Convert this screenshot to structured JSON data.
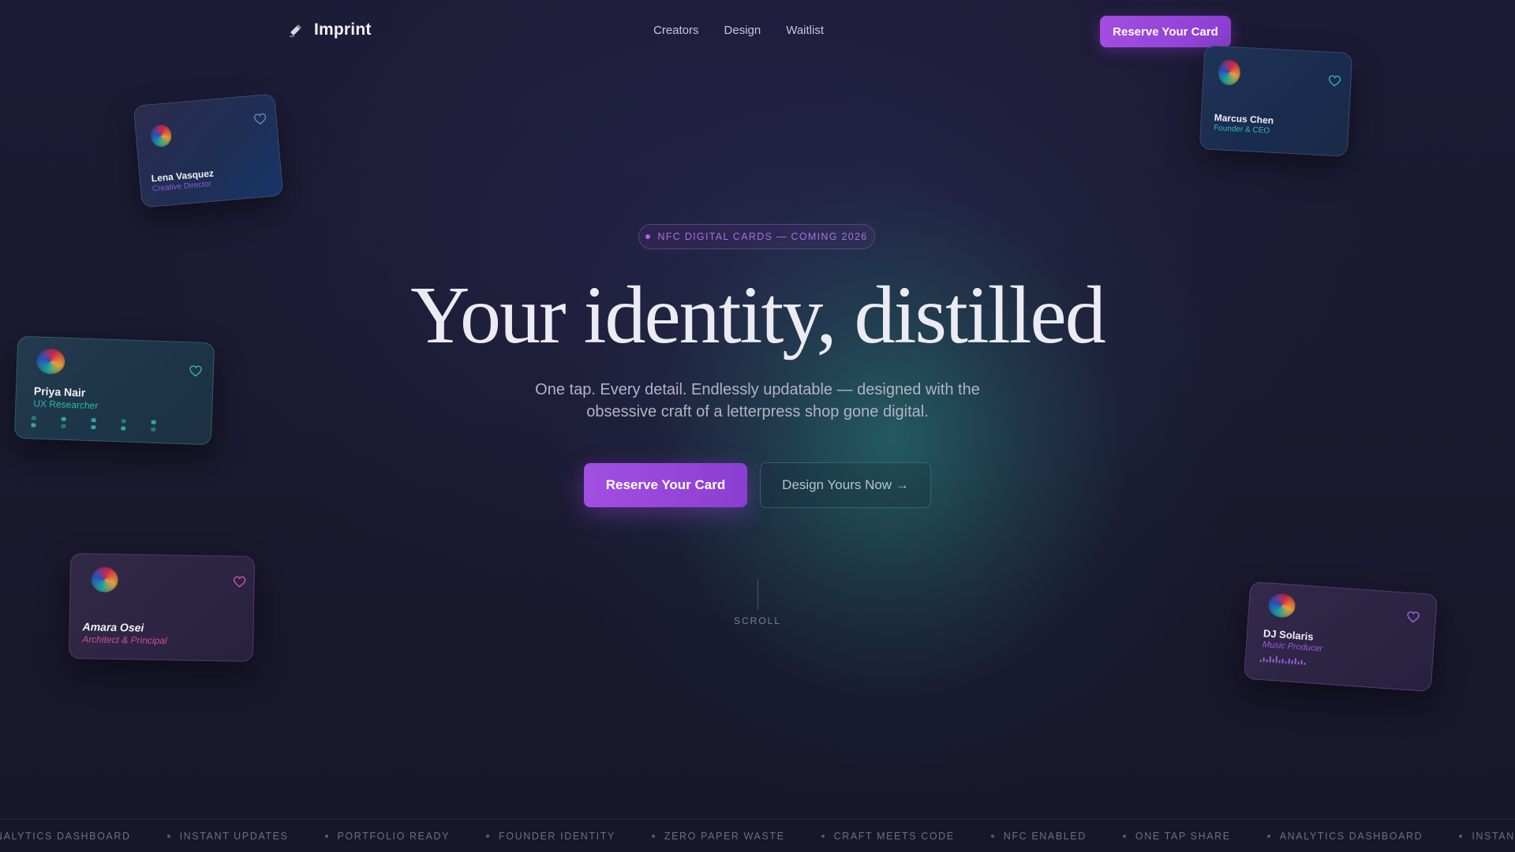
{
  "nav": {
    "brand": "Imprint",
    "links": [
      "Creators",
      "Design",
      "Waitlist"
    ],
    "cta_label": "Reserve Your Card"
  },
  "hero": {
    "badge": "NFC DIGITAL CARDS — COMING 2026",
    "title": "Your identity, distilled",
    "subtitle": "One tap. Every detail. Endlessly updatable — designed with the obsessive craft of a letterpress shop gone digital.",
    "primary_cta": "Reserve Your Card",
    "secondary_cta": "Design Yours Now →",
    "scroll_label": "SCROLL"
  },
  "cards": [
    {
      "name": "Lena Vasquez",
      "role": "Creative Director",
      "role_color": "#8b5bd8"
    },
    {
      "name": "Marcus Chen",
      "role": "Founder & CEO",
      "role_color": "#2fb7c4"
    },
    {
      "name": "Priya Nair",
      "role": "UX Researcher",
      "role_color": "#2bb7a8"
    },
    {
      "name": "Amara Osei",
      "role": "Architect & Principal",
      "role_color": "#d04aa0"
    },
    {
      "name": "DJ Solaris",
      "role": "Music Producer",
      "role_color": "#9a5cd8"
    }
  ],
  "ticker": [
    "ANALYTICS DASHBOARD",
    "INSTANT UPDATES",
    "PORTFOLIO READY",
    "FOUNDER IDENTITY",
    "ZERO PAPER WASTE",
    "CRAFT MEETS CODE",
    "NFC ENABLED",
    "ONE TAP SHARE",
    "ANALYTICS DASHBOARD",
    "INSTANT UPDATES"
  ],
  "colors": {
    "accent_purple": "#9b47dc",
    "accent_teal": "#2aa39a",
    "background": "#181728"
  }
}
